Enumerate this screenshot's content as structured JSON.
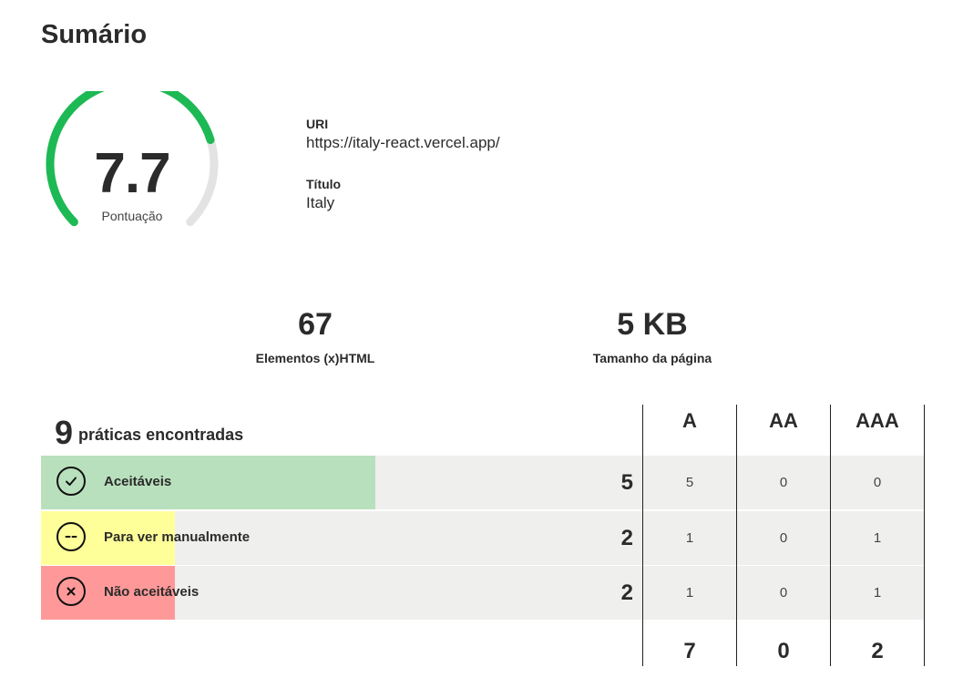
{
  "summary": {
    "title": "Sumário",
    "score": "7.7",
    "score_value": 7.7,
    "score_max": 10,
    "score_label": "Pontuação",
    "gauge_color": "#1db954",
    "uri_label": "URI",
    "uri": "https://italy-react.vercel.app/",
    "title_label": "Título",
    "page_title": "Italy"
  },
  "stats": {
    "elements_value": "67",
    "elements_label": "Elementos (x)HTML",
    "size_value": "5 KB",
    "size_label": "Tamanho da página"
  },
  "practices": {
    "count": "9",
    "title": "práticas encontradas",
    "columns": [
      "A",
      "AA",
      "AAA"
    ],
    "rows": [
      {
        "label": "Aceitáveis",
        "total": "5",
        "values": [
          "5",
          "0",
          "0"
        ],
        "color": "#b9e0bd",
        "fraction": 0.556,
        "icon": "check-icon"
      },
      {
        "label": "Para ver manualmente",
        "total": "2",
        "values": [
          "1",
          "0",
          "1"
        ],
        "color": "#ffff99",
        "fraction": 0.222,
        "icon": "dash-icon"
      },
      {
        "label": "Não aceitáveis",
        "total": "2",
        "values": [
          "1",
          "0",
          "1"
        ],
        "color": "#ff9999",
        "fraction": 0.222,
        "icon": "close-icon"
      }
    ],
    "totals": [
      "7",
      "0",
      "2"
    ]
  }
}
